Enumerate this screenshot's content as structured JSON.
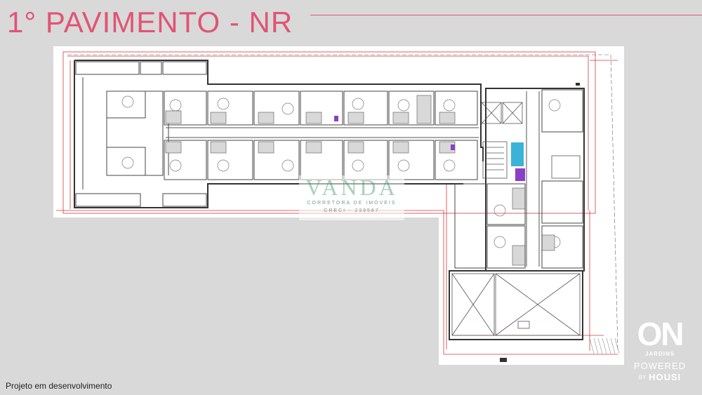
{
  "page_title": "1° PAVIMENTO - NR",
  "footnote": "Projeto em desenvolvimento",
  "watermark": {
    "name": "VANDA",
    "subtitle": "CORRETORA DE IMÓVEIS",
    "creci": "CRECI - 239567"
  },
  "logo": {
    "on": "ON",
    "jardins": "JARDINS",
    "powered": "POWERED",
    "by": "BY",
    "housi": "HOUSI"
  },
  "colors": {
    "background": "#d9d9d9",
    "accent": "#e05574",
    "plan_background": "#ffffff",
    "wall": "#3a3a3a",
    "boundary_line": "#d23a3a"
  }
}
